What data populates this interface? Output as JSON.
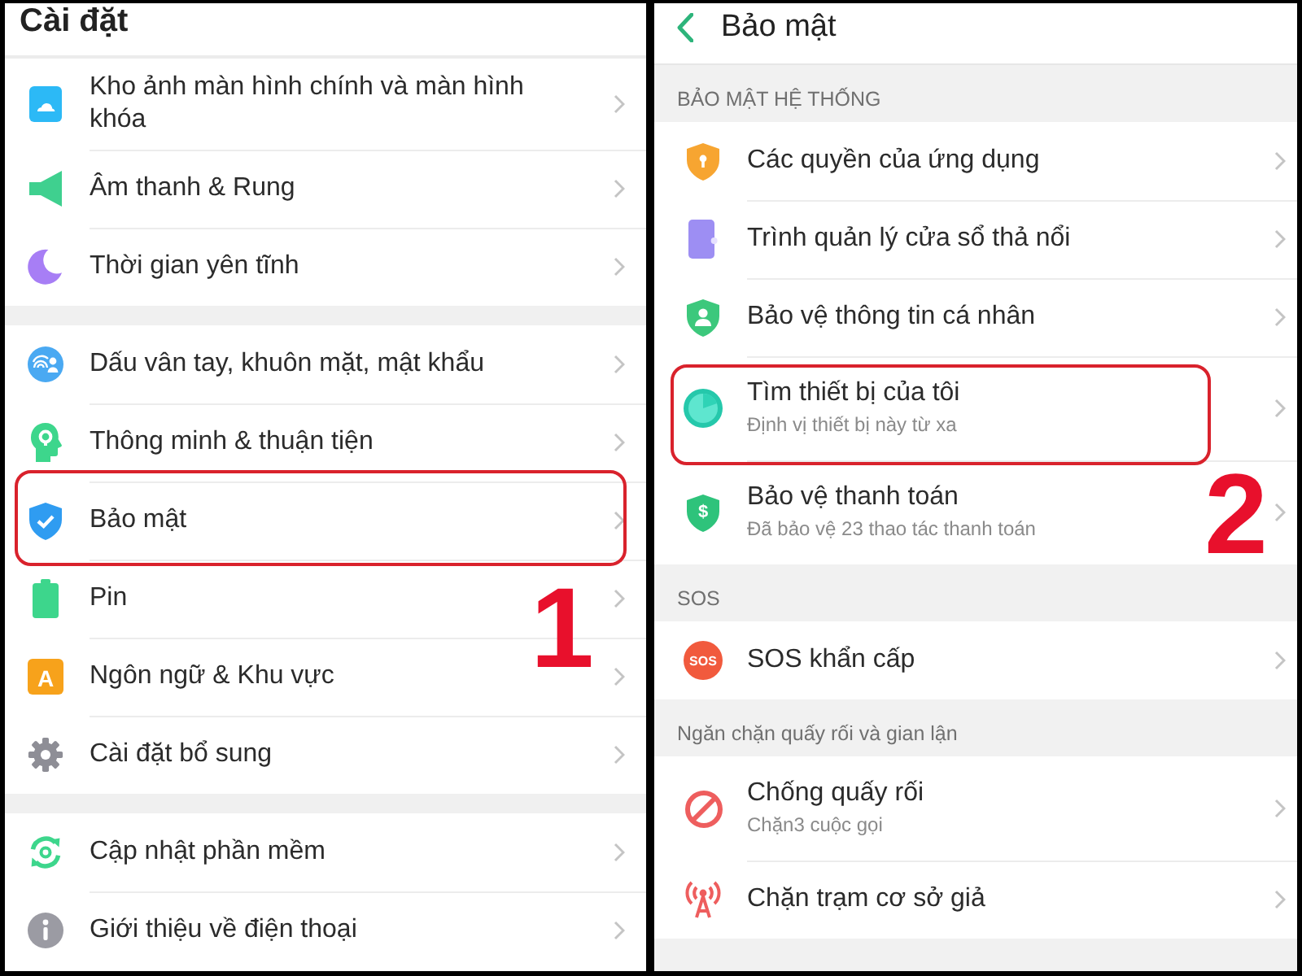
{
  "settings_screen": {
    "title": "Cài đặt",
    "step_number": "1",
    "groups": [
      {
        "items": [
          {
            "label": "Kho ảnh màn hình chính và màn hình khóa",
            "highlighted": false
          },
          {
            "label": "Âm thanh & Rung",
            "highlighted": false
          },
          {
            "label": "Thời gian yên tĩnh",
            "highlighted": false
          }
        ]
      },
      {
        "items": [
          {
            "label": "Dấu vân tay, khuôn mặt, mật khẩu",
            "highlighted": false
          },
          {
            "label": "Thông minh & thuận tiện",
            "highlighted": false
          },
          {
            "label": "Bảo mật",
            "highlighted": true
          },
          {
            "label": "Pin",
            "highlighted": false
          },
          {
            "label": "Ngôn ngữ & Khu vực",
            "icon_text": "A",
            "highlighted": false
          },
          {
            "label": "Cài đặt bổ sung",
            "highlighted": false
          }
        ]
      },
      {
        "items": [
          {
            "label": "Cập nhật phần mềm",
            "highlighted": false
          },
          {
            "label": "Giới thiệu về điện thoại",
            "highlighted": false
          }
        ]
      }
    ]
  },
  "security_screen": {
    "title": "Bảo mật",
    "step_number": "2",
    "sections": [
      {
        "header": "BẢO MẬT HỆ THỐNG",
        "items": [
          {
            "label": "Các quyền của ứng dụng",
            "highlighted": false
          },
          {
            "label": "Trình quản lý cửa sổ thả nổi",
            "highlighted": false
          },
          {
            "label": "Bảo vệ thông tin cá nhân",
            "highlighted": false
          },
          {
            "label": "Tìm thiết bị của tôi",
            "subtitle": "Định vị thiết bị này từ xa",
            "highlighted": true
          },
          {
            "label": "Bảo vệ thanh toán",
            "subtitle": "Đã bảo vệ 23 thao tác thanh toán",
            "icon_text": "$",
            "highlighted": false
          }
        ]
      },
      {
        "header": "SOS",
        "items": [
          {
            "label": "SOS khẩn cấp",
            "icon_text": "SOS",
            "highlighted": false
          }
        ]
      },
      {
        "header": "Ngăn chặn quấy rối và gian lận",
        "items": [
          {
            "label": "Chống quấy rối",
            "subtitle": "Chặn3 cuộc gọi",
            "highlighted": false
          },
          {
            "label": "Chặn trạm cơ sở giả",
            "highlighted": false
          }
        ]
      }
    ]
  }
}
